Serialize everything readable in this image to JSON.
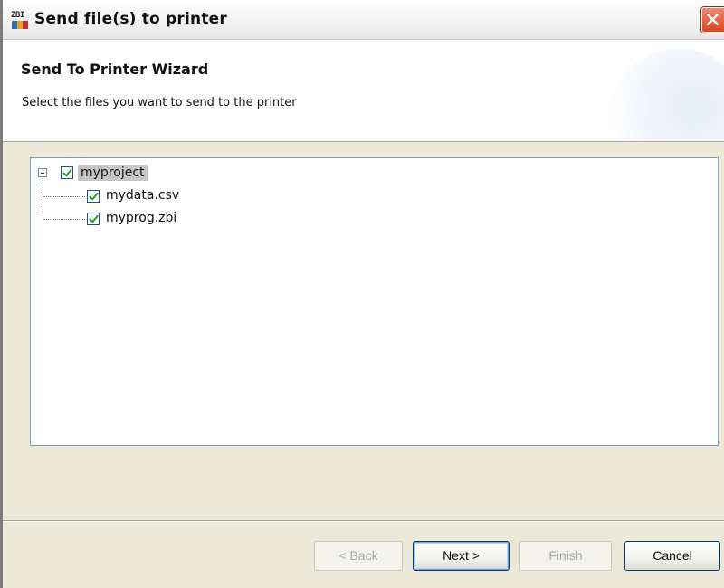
{
  "window": {
    "title": "Send file(s) to printer",
    "icon": "zbi-app-icon",
    "icon_text": "ZBI",
    "close_icon": "close-icon"
  },
  "wizard": {
    "title": "Send To Printer Wizard",
    "subtitle": "Select the files you want to send to the printer"
  },
  "tree": {
    "root": {
      "label": "myproject",
      "checked": true,
      "expanded": true,
      "selected": true
    },
    "children": [
      {
        "label": "mydata.csv",
        "checked": true
      },
      {
        "label": "myprog.zbi",
        "checked": true
      }
    ]
  },
  "buttons": {
    "back": "< Back",
    "next": "Next >",
    "finish": "Finish",
    "cancel": "Cancel"
  },
  "colors": {
    "accent": "#1c5180",
    "check": "#21a121",
    "close": "#d8451f",
    "selection": "#c6c6c6"
  }
}
